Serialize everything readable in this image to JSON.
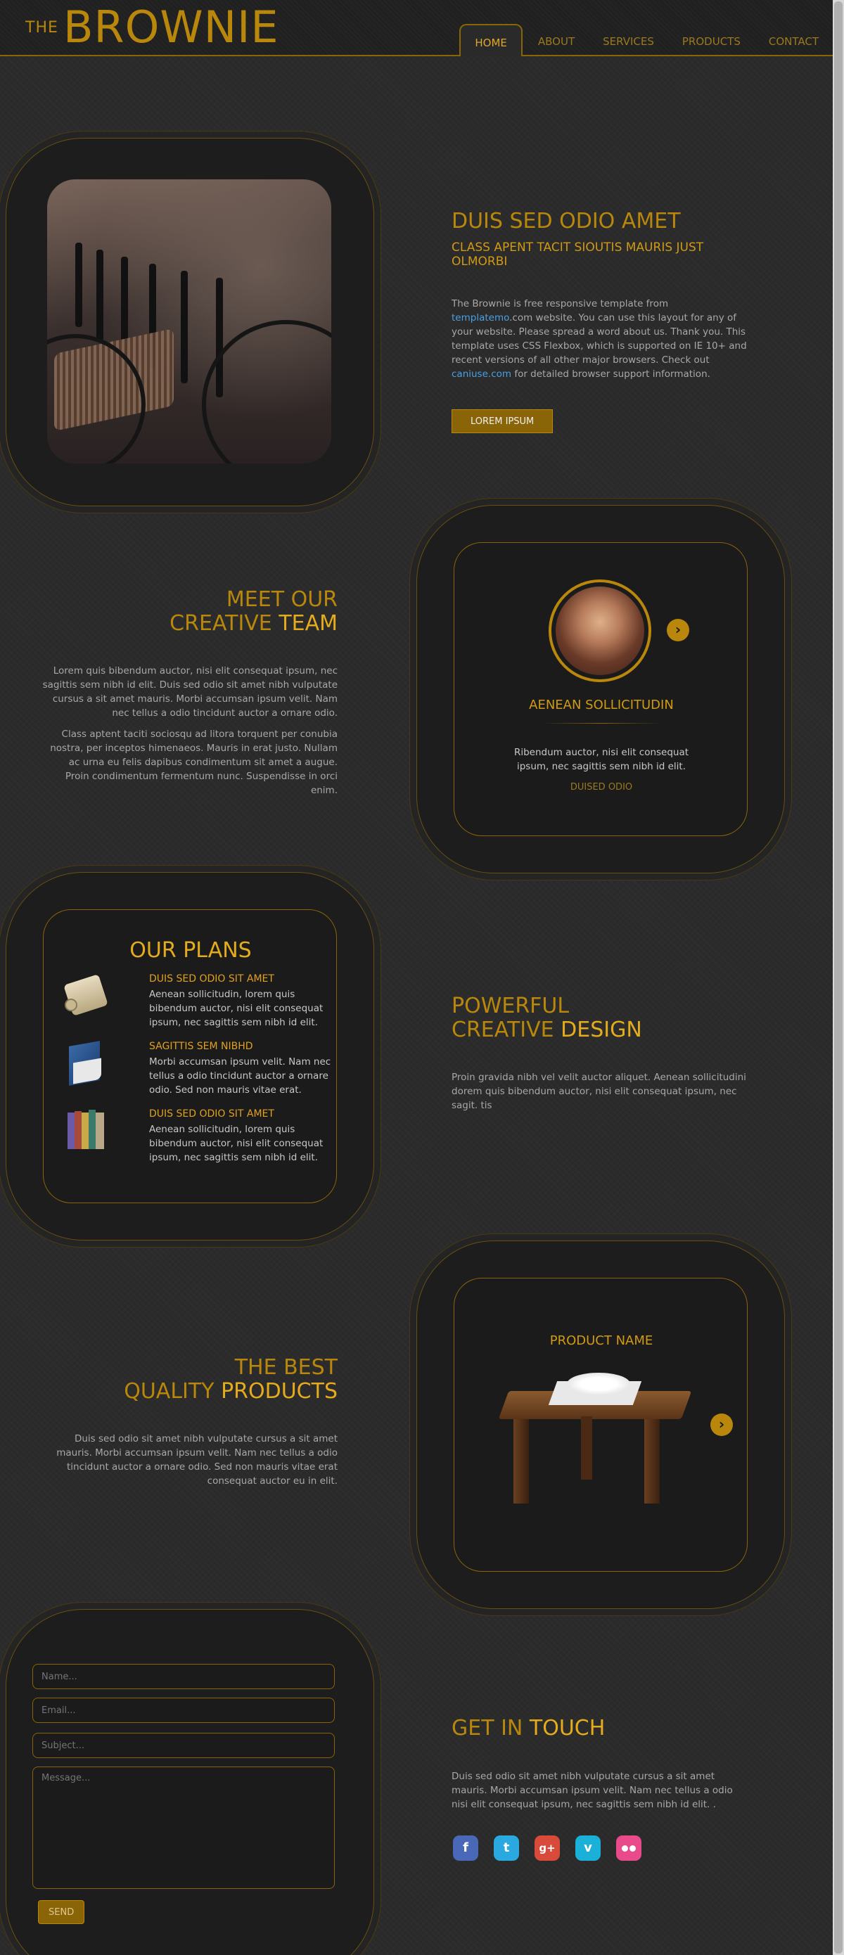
{
  "header": {
    "logo_prefix": "THE",
    "logo_name": "BROWNIE",
    "nav": [
      "HOME",
      "ABOUT",
      "SERVICES",
      "PRODUCTS",
      "CONTACT"
    ]
  },
  "intro": {
    "title": "DUIS SED ODIO AMET",
    "subtitle": "CLASS APENT TACIT SIOUTIS MAURIS JUST OLMORBI",
    "text_1": "The Brownie is free responsive template from ",
    "link_1_a": "templatemo",
    "link_1_b": ".com",
    "text_2": " website. You can use this layout for any of your website. Please spread a word about us. Thank you. This template uses CSS Flexbox, which is supported on IE 10+ and recent versions of all other major browsers. Check out ",
    "link_2": "caniuse.com",
    "text_3": " for detailed browser support information.",
    "button": "LOREM IPSUM"
  },
  "team": {
    "title_1": "MEET OUR",
    "title_2a": "CREATIVE ",
    "title_2b": "TEAM",
    "para_1": "Lorem quis bibendum auctor, nisi elit consequat ipsum, nec sagittis sem nibh id elit. Duis sed odio sit amet nibh vulputate cursus a sit amet mauris. Morbi accumsan ipsum velit. Nam nec tellus a odio tincidunt auctor a ornare odio.",
    "para_2": "Class aptent taciti sociosqu ad litora torquent per conubia nostra, per inceptos himenaeos. Mauris in erat justo. Nullam ac urna eu felis dapibus condimentum sit amet a augue. Proin condimentum fermentum nunc. Suspendisse in orci enim.",
    "member_name": "AENEAN SOLLICITUDIN",
    "member_text": "Ribendum auctor, nisi elit consequat ipsum, nec sagittis sem nibh id elit.",
    "member_role": "DUISED ODIO"
  },
  "plans": {
    "title": "OUR PLANS",
    "items": [
      {
        "title": "DUIS SED ODIO SIT AMET",
        "text": "Aenean sollicitudin, lorem quis bibendum auctor, nisi elit consequat ipsum, nec sagittis sem nibh id elit."
      },
      {
        "title": "SAGITTIS SEM NIBHD",
        "text": "Morbi accumsan ipsum velit. Nam nec tellus a odio tincidunt auctor a ornare odio. Sed non mauris vitae erat."
      },
      {
        "title": "DUIS SED ODIO SIT AMET",
        "text": "Aenean sollicitudin, lorem quis bibendum auctor, nisi elit consequat ipsum, nec sagittis sem nibh id elit."
      }
    ]
  },
  "design": {
    "title_1": "POWERFUL",
    "title_2a": "CREATIVE ",
    "title_2b": "DESIGN",
    "text": "Proin gravida nibh vel velit auctor aliquet. Aenean sollicitudini dorem quis bibendum auctor, nisi elit consequat ipsum, nec sagit. tis"
  },
  "products": {
    "title_1": "THE BEST",
    "title_2a": "QUALITY ",
    "title_2b": "PRODUCTS",
    "text": "Duis sed odio sit amet nibh vulputate cursus a sit amet mauris. Morbi accumsan ipsum velit. Nam nec tellus a odio tincidunt auctor a ornare odio. Sed non mauris vitae erat consequat auctor eu in elit.",
    "product_name": "PRODUCT NAME"
  },
  "contact": {
    "name_placeholder": "Name...",
    "email_placeholder": "Email...",
    "subject_placeholder": "Subject...",
    "message_placeholder": "Message...",
    "send": "SEND",
    "title_a": "GET IN ",
    "title_b": "TOUCH",
    "text": "Duis sed odio sit amet nibh vulputate cursus a sit amet mauris. Morbi accumsan ipsum velit. Nam nec tellus a odio nisi elit consequat ipsum, nec sagittis sem nibh id elit. .",
    "social_icons": [
      "facebook-icon",
      "twitter-icon",
      "google-plus-icon",
      "vimeo-icon",
      "flickr-icon"
    ]
  },
  "colors": {
    "gold": "#b8870b",
    "bright_gold": "#e4ac1c",
    "background": "#2b2b2b"
  }
}
